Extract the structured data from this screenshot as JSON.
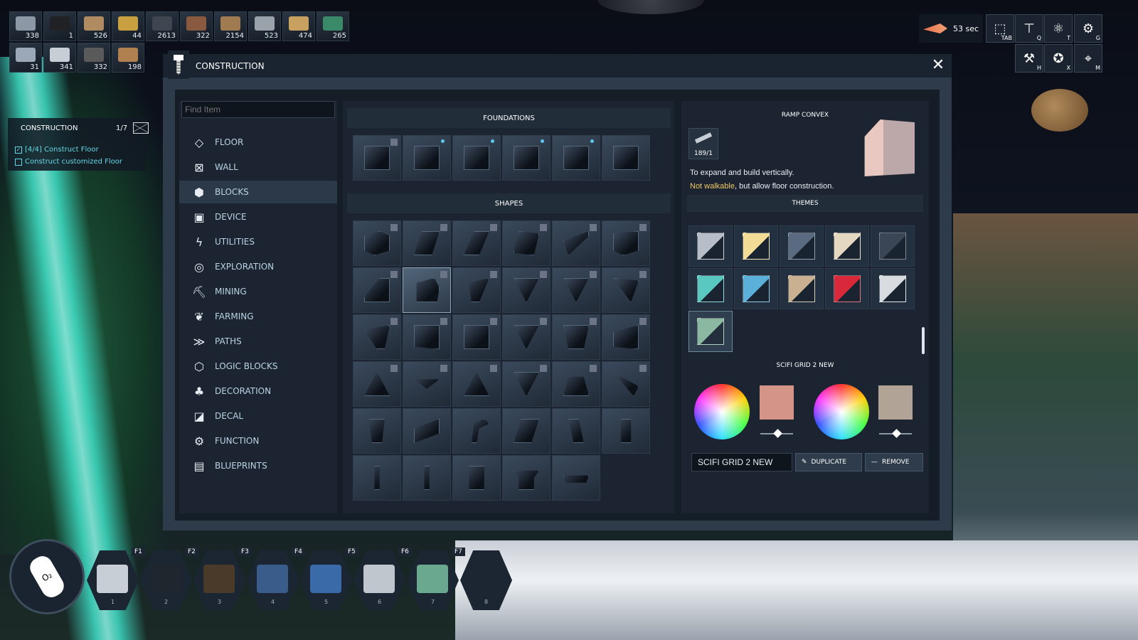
{
  "inventory": [
    {
      "icon": "metal-ingot-icon",
      "count": "338",
      "color": "#8c98a6"
    },
    {
      "icon": "coal-icon",
      "count": "1",
      "color": "#202226"
    },
    {
      "icon": "wood-plank-icon",
      "count": "526",
      "color": "#b08a60"
    },
    {
      "icon": "gold-bar-icon",
      "count": "44",
      "color": "#c8a040"
    },
    {
      "icon": "mesh-sheet-icon",
      "count": "2613",
      "color": "#404650"
    },
    {
      "icon": "copper-sheet-icon",
      "count": "322",
      "color": "#8a5a40"
    },
    {
      "icon": "wood-spool-icon",
      "count": "2154",
      "color": "#a07a50"
    },
    {
      "icon": "metal-spool-icon",
      "count": "523",
      "color": "#9aa2aa"
    },
    {
      "icon": "gold-spool-icon",
      "count": "474",
      "color": "#c8a060"
    },
    {
      "icon": "circuit-icon",
      "count": "265",
      "color": "#3a8a6a"
    },
    {
      "icon": "glass-pane-icon",
      "count": "31",
      "color": "#9aa8b8"
    },
    {
      "icon": "metal-cube-icon",
      "count": "341",
      "color": "#c8ced6"
    },
    {
      "icon": "iron-ore-icon",
      "count": "332",
      "color": "#5a5a5a"
    },
    {
      "icon": "copper-ore-icon",
      "count": "198",
      "color": "#b08050"
    }
  ],
  "top_right": {
    "timer": "53 sec",
    "buttons": [
      {
        "name": "inventory-button",
        "glyph": "⬚",
        "key": "TAB"
      },
      {
        "name": "construction-button",
        "glyph": "⊤",
        "key": "Q"
      },
      {
        "name": "tech-button",
        "glyph": "⚛",
        "key": "T"
      },
      {
        "name": "gear-button",
        "glyph": "⚙",
        "key": "G"
      },
      {
        "name": "hammer-button",
        "glyph": "⚒",
        "key": "H"
      },
      {
        "name": "xp-button",
        "glyph": "✪",
        "key": "X"
      },
      {
        "name": "map-button",
        "glyph": "⌖",
        "key": "M"
      }
    ]
  },
  "quest": {
    "title": "CONSTRUCTION",
    "count": "1/7",
    "items": [
      {
        "label": "[4/4] Construct Floor",
        "done": true,
        "mark": "✓"
      },
      {
        "label": "Construct customized Floor",
        "done": false,
        "mark": ""
      }
    ]
  },
  "window": {
    "title": "CONSTRUCTION",
    "close": "✕"
  },
  "search": {
    "placeholder": "Find Item"
  },
  "categories": [
    {
      "label": "FLOOR",
      "icon": "floor-icon",
      "glyph": "◇"
    },
    {
      "label": "WALL",
      "icon": "wall-icon",
      "glyph": "⊠"
    },
    {
      "label": "BLOCKS",
      "icon": "blocks-icon",
      "glyph": "⬢"
    },
    {
      "label": "DEVICE",
      "icon": "device-icon",
      "glyph": "▣"
    },
    {
      "label": "UTILITIES",
      "icon": "utilities-icon",
      "glyph": "ϟ"
    },
    {
      "label": "EXPLORATION",
      "icon": "exploration-icon",
      "glyph": "◎"
    },
    {
      "label": "MINING",
      "icon": "mining-icon",
      "glyph": "⛏"
    },
    {
      "label": "FARMING",
      "icon": "farming-icon",
      "glyph": "❦"
    },
    {
      "label": "PATHS",
      "icon": "paths-icon",
      "glyph": "≫"
    },
    {
      "label": "LOGIC BLOCKS",
      "icon": "logic-blocks-icon",
      "glyph": "⬡"
    },
    {
      "label": "DECORATION",
      "icon": "decoration-icon",
      "glyph": "♣"
    },
    {
      "label": "DECAL",
      "icon": "decal-icon",
      "glyph": "◪"
    },
    {
      "label": "FUNCTION",
      "icon": "function-icon",
      "glyph": "⚙"
    },
    {
      "label": "BLUEPRINTS",
      "icon": "blueprints-icon",
      "glyph": "▤"
    }
  ],
  "selected_category": "BLOCKS",
  "foundations_header": "FOUNDATIONS",
  "shapes_header": "SHAPES",
  "detail": {
    "title": "RAMP CONVEX",
    "cost": "189/1",
    "desc_line1": "To expand and build vertically.",
    "warn": "Not walkable",
    "desc_line2": ", but allow floor construction.",
    "themes_header": "THEMES",
    "theme_name": "SCIFI GRID 2 NEW",
    "theme_input": "SCIFI GRID 2 NEW",
    "duplicate": "DUPLICATE",
    "remove": "REMOVE",
    "swatch1": "#d49487",
    "swatch2": "#b1a496"
  },
  "themes": [
    {
      "name": "striped-metal-theme",
      "color": "#b8bec8"
    },
    {
      "name": "cream-panel-theme",
      "color": "#f2dc96"
    },
    {
      "name": "dark-crate-theme",
      "color": "#5a6a80"
    },
    {
      "name": "light-crate-theme",
      "color": "#e4d8c0"
    },
    {
      "name": "wire-frame-theme",
      "color": "#3a4656"
    },
    {
      "name": "teal-frame-theme",
      "color": "#58c8c0"
    },
    {
      "name": "blue-tile-theme",
      "color": "#5ab0d8"
    },
    {
      "name": "wood-crate-theme",
      "color": "#c8b090"
    },
    {
      "name": "red-theme",
      "color": "#d8283a"
    },
    {
      "name": "white-panel-theme",
      "color": "#d8dce0"
    },
    {
      "name": "scifi-grid-theme",
      "color": "#8ab8a0"
    }
  ],
  "hotbar": [
    {
      "key": "F1",
      "num": "1",
      "color": "#c8ced6"
    },
    {
      "key": "F2",
      "num": "2",
      "color": "#20262e"
    },
    {
      "key": "F3",
      "num": "3",
      "color": "#4a3a2a"
    },
    {
      "key": "F4",
      "num": "4",
      "color": "#3a5c8a"
    },
    {
      "key": "F5",
      "num": "5",
      "color": "#3a6aa8"
    },
    {
      "key": "F6",
      "num": "6",
      "color": "#c0c6ce"
    },
    {
      "key": "F7",
      "num": "7",
      "color": "#6aa890"
    },
    {
      "key": "",
      "num": "8",
      "color": ""
    }
  ],
  "oxygen_label": "O₂"
}
